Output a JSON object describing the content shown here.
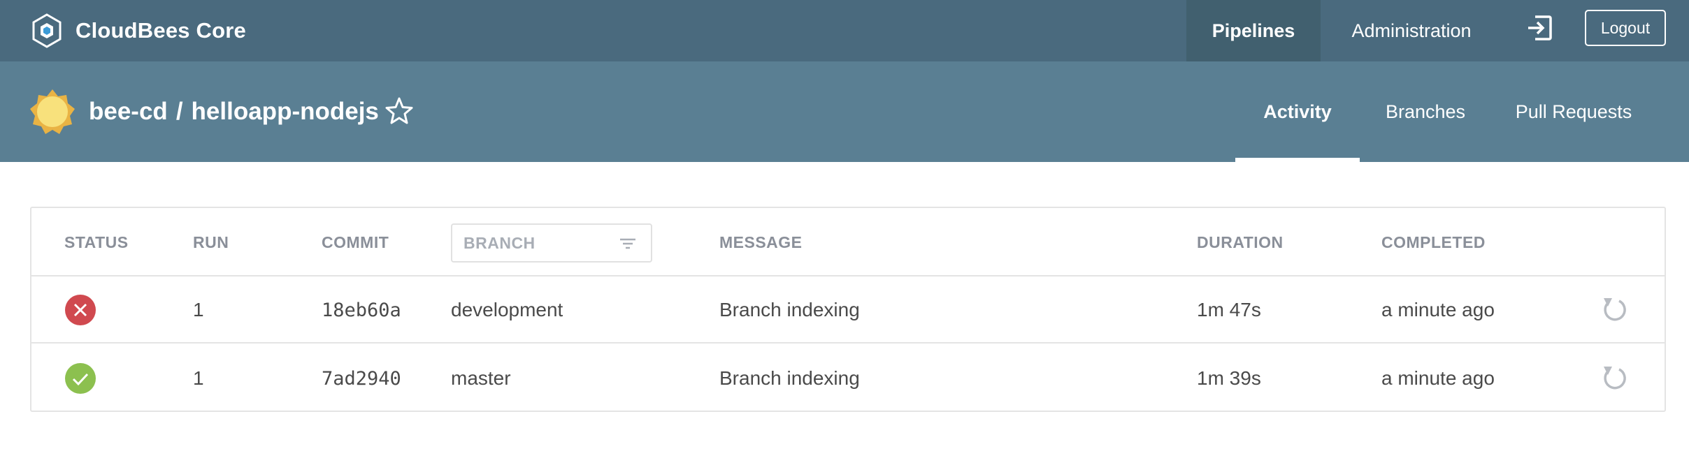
{
  "app": {
    "name": "CloudBees Core"
  },
  "topnav": {
    "pipelines_label": "Pipelines",
    "administration_label": "Administration",
    "logout_label": "Logout"
  },
  "pipeline": {
    "organization": "bee-cd",
    "separator": "/",
    "name": "helloapp-nodejs",
    "weather_icon": "sunny-icon",
    "tabs": {
      "activity": "Activity",
      "branches": "Branches",
      "pull_requests": "Pull Requests"
    },
    "active_tab": "Activity"
  },
  "table": {
    "headers": {
      "status": "STATUS",
      "run": "RUN",
      "commit": "COMMIT",
      "branch_filter_placeholder": "BRANCH",
      "message": "MESSAGE",
      "duration": "DURATION",
      "completed": "COMPLETED"
    },
    "rows": [
      {
        "status": "failed",
        "run": "1",
        "commit": "18eb60a",
        "branch": "development",
        "message": "Branch indexing",
        "duration": "1m 47s",
        "completed": "a minute ago"
      },
      {
        "status": "success",
        "run": "1",
        "commit": "7ad2940",
        "branch": "master",
        "message": "Branch indexing",
        "duration": "1m 39s",
        "completed": "a minute ago"
      }
    ]
  },
  "colors": {
    "topbar": "#4a6a7e",
    "topbar_active": "#41606f",
    "header": "#5a7f93",
    "failed": "#d0494f",
    "success": "#8cc04f",
    "weather_sun": "#f8e17c"
  }
}
